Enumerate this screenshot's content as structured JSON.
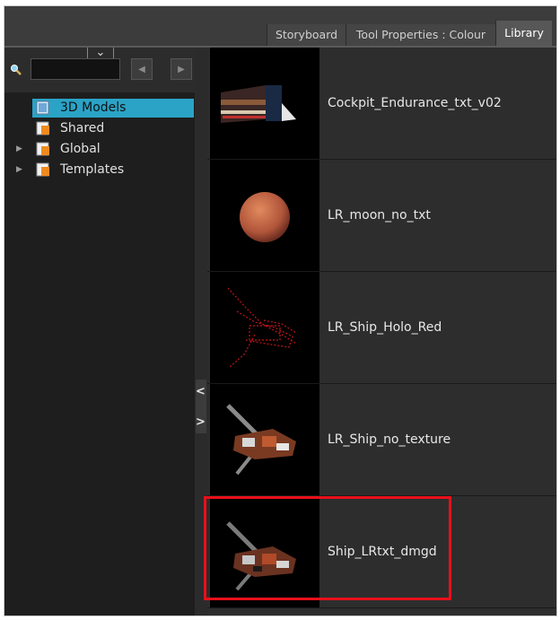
{
  "tabs": [
    {
      "label": "Storyboard",
      "active": false
    },
    {
      "label": "Tool Properties : Colour",
      "active": false
    },
    {
      "label": "Library",
      "active": true
    }
  ],
  "search": {
    "value": "",
    "placeholder": ""
  },
  "tree": [
    {
      "label": "3D Models",
      "selected": true,
      "expandable": false
    },
    {
      "label": "Shared",
      "selected": false,
      "expandable": false
    },
    {
      "label": "Global",
      "selected": false,
      "expandable": true
    },
    {
      "label": "Templates",
      "selected": false,
      "expandable": true
    }
  ],
  "items": [
    {
      "name": "Cockpit_Endurance_txt_v02",
      "thumbnail": "cockpit-model"
    },
    {
      "name": "LR_moon_no_txt",
      "thumbnail": "moon-sphere"
    },
    {
      "name": "LR_Ship_Holo_Red",
      "thumbnail": "ship-hologram-red"
    },
    {
      "name": "LR_Ship_no_texture",
      "thumbnail": "ship-model"
    },
    {
      "name": "Ship_LRtxt_dmgd",
      "thumbnail": "ship-model-damaged",
      "highlighted": true
    }
  ],
  "colors": {
    "selection": "#2aa3c6",
    "highlight_border": "#e8101a",
    "panel_bg": "#1e1e1e",
    "list_bg": "#2d2d2d"
  }
}
